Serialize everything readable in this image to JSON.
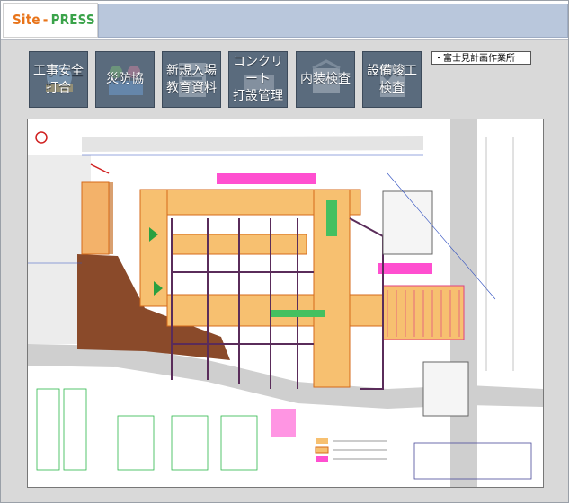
{
  "logo": {
    "part1": "Site",
    "sep": "-",
    "part2": "PRESS"
  },
  "toolbar": {
    "buttons": [
      {
        "label": "工事安全\n打合"
      },
      {
        "label": "災防協"
      },
      {
        "label": "新規入場\n教育資料"
      },
      {
        "label": "コンクリート\n打設管理"
      },
      {
        "label": "内装検査"
      },
      {
        "label": "設備竣工\n検査"
      }
    ]
  },
  "site_selector": {
    "value": "・富士見計画作業所"
  },
  "colors": {
    "accent_orange": "#e8741a",
    "accent_green": "#3aa34a",
    "toolbar_button": "#5a6b7d",
    "title_strip": "#b9c7dc"
  }
}
